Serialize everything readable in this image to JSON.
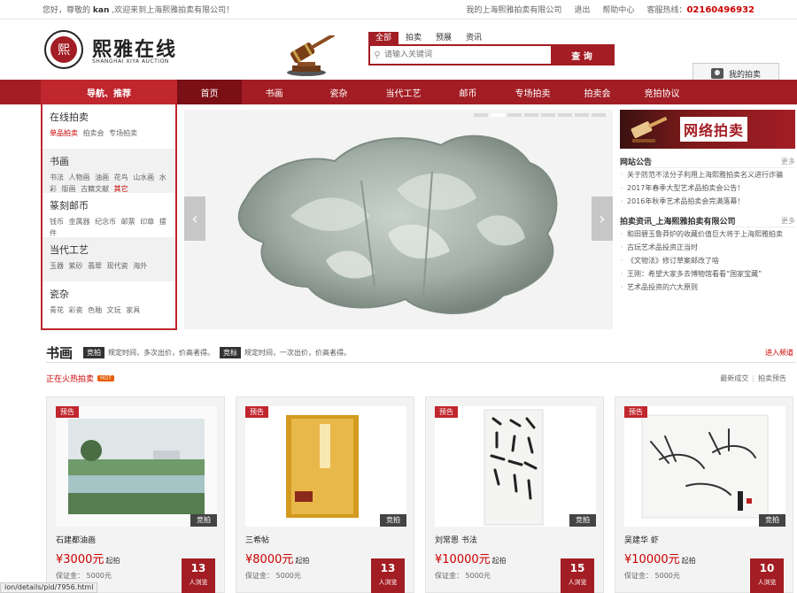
{
  "topbar": {
    "greeting_prefix": "您好，尊敬的",
    "username": "kan",
    "greeting_suffix": ",欢迎来到上海熙雅拍卖有限公司！",
    "company_link": "我的上海熙雅拍卖有限公司",
    "logout": "退出",
    "help": "帮助中心",
    "hotline_label": "客服热线：",
    "hotline": "02160496932"
  },
  "header": {
    "logo_glyph": "熙",
    "logo_cn": "熙雅在线",
    "logo_en": "SHANGHAI XIYA AUCTION",
    "search_tabs": [
      "全部",
      "拍卖",
      "预展",
      "资讯"
    ],
    "search_placeholder": "请输入关键词",
    "search_button": "查 询",
    "my_auction": "我的拍卖"
  },
  "nav": {
    "guide": "导航、推荐",
    "items": [
      "首页",
      "书画",
      "瓷杂",
      "当代工艺",
      "邮币",
      "专场拍卖",
      "拍卖会",
      "竞拍协议"
    ]
  },
  "sidebar": [
    {
      "title": "在线拍卖",
      "links": [
        "单品拍卖",
        "拍卖会",
        "专场拍卖"
      ]
    },
    {
      "title": "书画",
      "links": [
        "书法",
        "人物画",
        "油画",
        "花鸟",
        "山水画",
        "水彩",
        "版画",
        "古籍文献",
        "其它"
      ]
    },
    {
      "title": "篆刻邮币",
      "links": [
        "钱币",
        "金属器",
        "纪念币",
        "邮票",
        "印章",
        "摆件"
      ]
    },
    {
      "title": "当代工艺",
      "links": [
        "玉器",
        "紫砂",
        "翡翠",
        "现代瓷",
        "海外"
      ]
    },
    {
      "title": "瓷杂",
      "links": [
        "青花",
        "彩瓷",
        "色釉",
        "文玩",
        "家具"
      ]
    }
  ],
  "banner": {
    "arrow_left": "‹",
    "arrow_right": "›"
  },
  "right": {
    "promo_text": "网络拍卖",
    "notice_title": "网站公告",
    "notice_more": "更多",
    "notices": [
      "关于防范不法分子利用上海熙雅拍卖名义进行诈骗",
      "2017年春季大型艺术品拍卖会公告！",
      "2016年秋季艺术品拍卖会完满落幕！"
    ],
    "news_title": "拍卖资讯_上海熙雅拍卖有限公司",
    "news_more": "更多",
    "news": [
      "和田碧玉鲁莽炉的收藏价值巨大将于上海熙雅拍卖",
      "古玩艺术品投资正当时",
      "《文物法》修订草案邮改了啥",
      "王刚：希望大家多去博物馆看看“国家宝藏”",
      "艺术品投资的六大原则"
    ]
  },
  "section": {
    "title": "书画",
    "tag1": "竞拍",
    "desc1": "规定时间，多次出价，价高者得。",
    "tag2": "竞标",
    "desc2": "规定时间，一次出价，价高者得。",
    "enter": "进入频道",
    "hot": "正在火热拍卖",
    "hot_badge": "HOT",
    "latest": "最新成交",
    "preview": "拍卖预告"
  },
  "cards": [
    {
      "badge": "预告",
      "bid_label": "竞拍",
      "name": "石建都油画",
      "price": "¥3000元",
      "price_unit": "起拍",
      "deposit": "保证金：  5000元",
      "count": "13",
      "count_unit": "人浏览"
    },
    {
      "badge": "预告",
      "bid_label": "竞拍",
      "name": "三希帖",
      "price": "¥8000元",
      "price_unit": "起拍",
      "deposit": "保证金：  5000元",
      "count": "13",
      "count_unit": "人浏览"
    },
    {
      "badge": "预告",
      "bid_label": "竞拍",
      "name": "刘常恩 书法",
      "price": "¥10000元",
      "price_unit": "起拍",
      "deposit": "保证金：  5000元",
      "count": "15",
      "count_unit": "人浏览"
    },
    {
      "badge": "预告",
      "bid_label": "竞拍",
      "name": "吴建华 虾",
      "price": "¥10000元",
      "price_unit": "起拍",
      "deposit": "保证金：  5000元",
      "count": "10",
      "count_unit": "人浏览"
    }
  ],
  "statusbar": "ion/details/pid/7956.html"
}
